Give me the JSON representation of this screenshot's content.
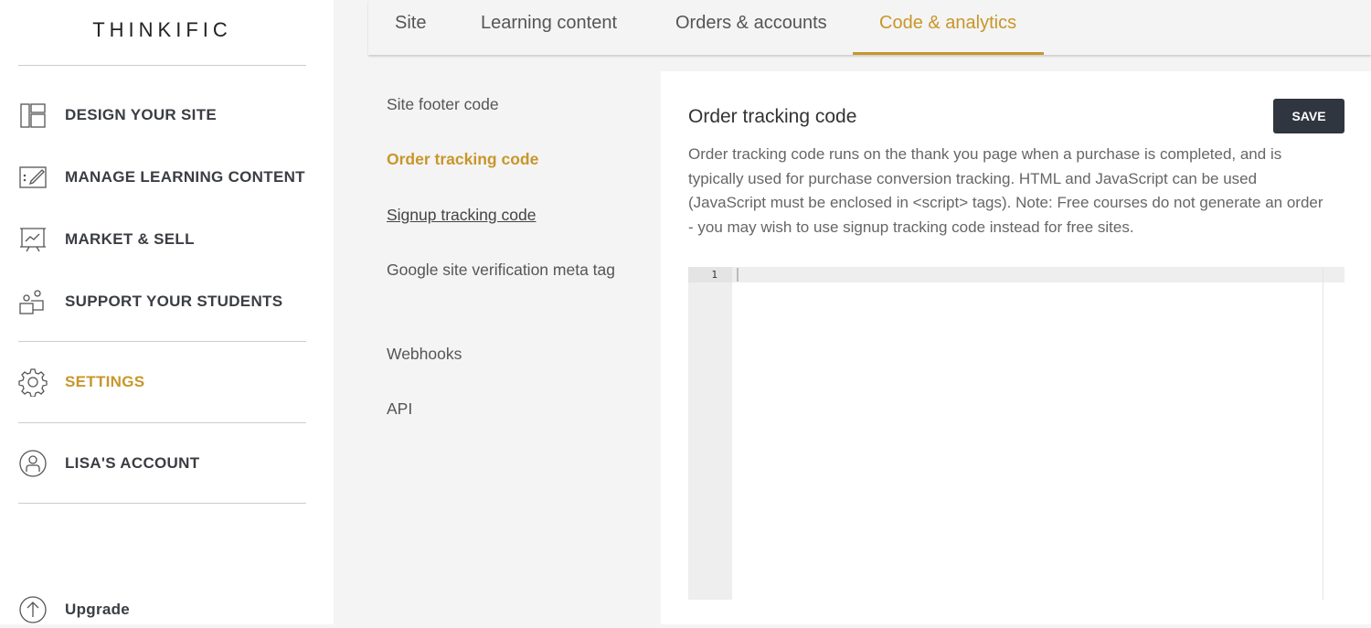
{
  "brand": "THINKIFIC",
  "sidebar": {
    "items": [
      {
        "label": "DESIGN YOUR SITE",
        "icon": "layout-icon"
      },
      {
        "label": "MANAGE LEARNING CONTENT",
        "icon": "edit-board-icon"
      },
      {
        "label": "MARKET & SELL",
        "icon": "presentation-chart-icon"
      },
      {
        "label": "SUPPORT YOUR STUDENTS",
        "icon": "students-icon"
      },
      {
        "label": "SETTINGS",
        "icon": "gear-icon",
        "active": true
      },
      {
        "label": "LISA'S ACCOUNT",
        "icon": "user-circle-icon"
      },
      {
        "label": "Upgrade",
        "icon": "arrow-up-circle-icon"
      }
    ]
  },
  "tabs": [
    {
      "label": "Site"
    },
    {
      "label": "Learning content"
    },
    {
      "label": "Orders & accounts"
    },
    {
      "label": "Code & analytics",
      "active": true
    }
  ],
  "subnav": [
    {
      "label": "Site footer code"
    },
    {
      "label": "Order tracking code",
      "active": true
    },
    {
      "label": "Signup tracking code"
    },
    {
      "label": "Google site verification meta tag"
    },
    {
      "label": "Webhooks"
    },
    {
      "label": "API"
    }
  ],
  "main": {
    "title": "Order tracking code",
    "save_label": "SAVE",
    "description": "Order tracking code runs on the thank you page when a purchase is completed, and is typically used for purchase conversion tracking. HTML and JavaScript can be used (JavaScript must be enclosed in <script> tags). Note: Free courses do not generate an order - you may wish to use signup tracking code instead for free sites.",
    "editor": {
      "line_number": "1",
      "value": ""
    }
  },
  "colors": {
    "accent": "#c8962a",
    "button": "#2f3640"
  }
}
